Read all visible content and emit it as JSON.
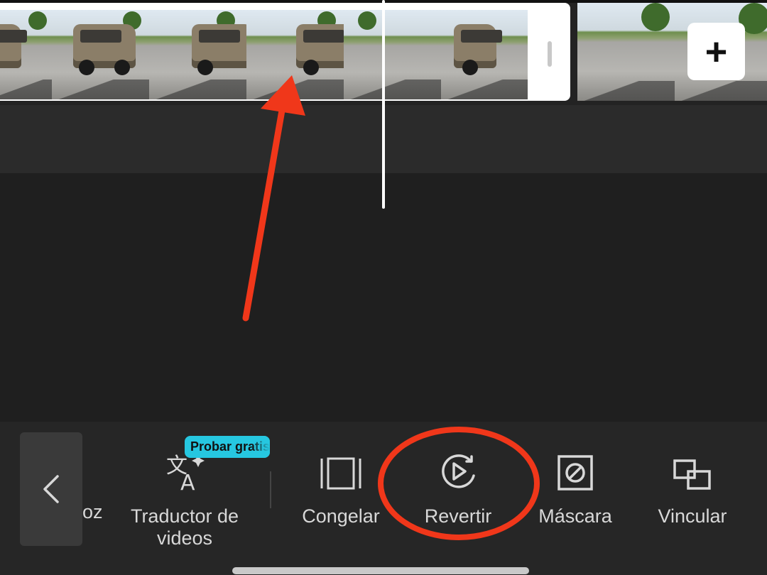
{
  "timeline": {
    "add_button_label": "+",
    "clip_frames": 6,
    "next_clip_frames": 2
  },
  "toolbar": {
    "back_icon": "chevron-left-icon",
    "partial_tool_label": "oz",
    "tools": [
      {
        "id": "translator",
        "label": "Traductor de\nvideos",
        "icon": "translate-icon",
        "badge": "Probar gratis"
      },
      {
        "id": "freeze",
        "label": "Congelar",
        "icon": "freeze-frame-icon"
      },
      {
        "id": "reverse",
        "label": "Revertir",
        "icon": "reverse-play-icon"
      },
      {
        "id": "mask",
        "label": "Máscara",
        "icon": "mask-icon"
      },
      {
        "id": "link",
        "label": "Vincular",
        "icon": "link-clips-icon"
      }
    ]
  },
  "annotation": {
    "arrow_color": "#f0371a",
    "circle_color": "#f0371a"
  }
}
